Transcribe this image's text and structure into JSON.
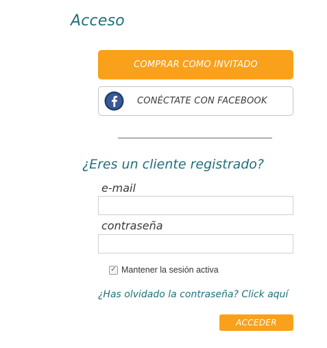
{
  "page": {
    "title": "Acceso"
  },
  "guest_button": {
    "label": "COMPRAR COMO INVITADO"
  },
  "facebook_button": {
    "label": "CONÉCTATE CON FACEBOOK",
    "icon": "facebook-icon"
  },
  "login": {
    "title": "¿Eres un cliente registrado?",
    "email_label": "e-mail",
    "email_value": "",
    "password_label": "contraseña",
    "password_value": "",
    "remember_label": "Mantener la sesión activa",
    "remember_checked": true,
    "forgot_link": "¿Has olvidado la contraseña? Click aquí",
    "submit_label": "ACCEDER"
  },
  "colors": {
    "accent_orange": "#f9a11b",
    "heading_teal": "#1f6f7c",
    "facebook_blue": "#3b5998",
    "facebook_ring": "#1d3f6e"
  }
}
